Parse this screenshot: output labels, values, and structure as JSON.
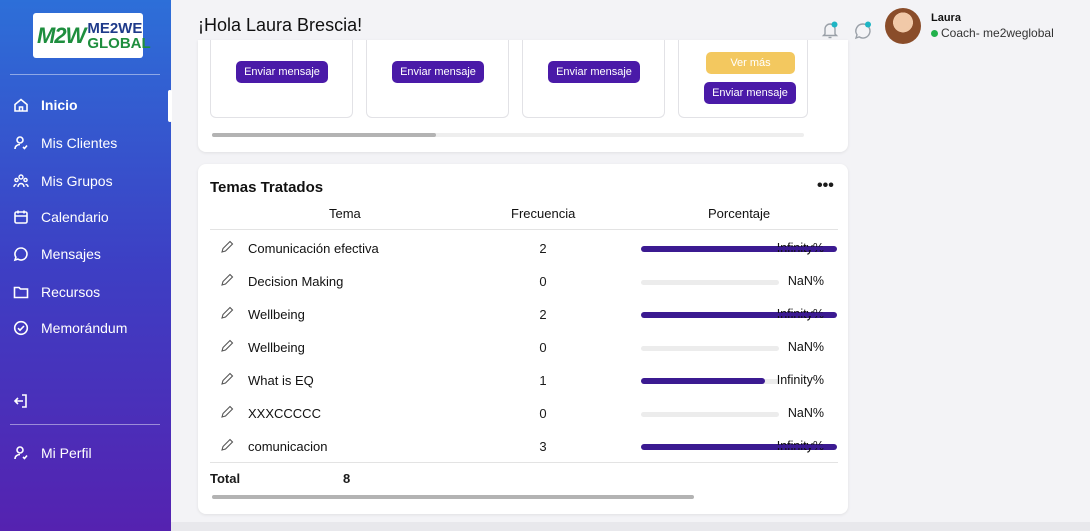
{
  "sidebar": {
    "logo": {
      "mark": "M2W",
      "line1": "ME2WE",
      "line2": "GLOBAL"
    },
    "items": [
      {
        "label": "Inicio",
        "icon": "home-icon",
        "active": true
      },
      {
        "label": "Mis Clientes",
        "icon": "user-icon"
      },
      {
        "label": "Mis Grupos",
        "icon": "group-icon"
      },
      {
        "label": "Calendario",
        "icon": "calendar-icon"
      },
      {
        "label": "Mensajes",
        "icon": "chat-icon"
      },
      {
        "label": "Recursos",
        "icon": "folder-icon"
      },
      {
        "label": "Memorándum",
        "icon": "check-circle-icon"
      }
    ],
    "logout_icon": "logout-icon",
    "profile": {
      "label": "Mi Perfil",
      "icon": "user-icon"
    }
  },
  "header": {
    "greeting": "¡Hola Laura Brescia!",
    "user": {
      "name": "Laura",
      "role": "Coach- me2weglobal",
      "status_color": "#22b14c"
    }
  },
  "clients_card": {
    "send_label": "Enviar mensaje",
    "more_label": "Ver más"
  },
  "topics": {
    "title": "Temas Tratados",
    "more": "•••",
    "columns": {
      "topic": "Tema",
      "frequency": "Frecuencia",
      "percentage": "Porcentaje"
    },
    "rows": [
      {
        "topic": "Comunicación efectiva",
        "frequency": "2",
        "percentage": "Infinity%",
        "fill": 1.0
      },
      {
        "topic": "Decision Making",
        "frequency": "0",
        "percentage": "NaN%",
        "fill": 0
      },
      {
        "topic": "Wellbeing",
        "frequency": "2",
        "percentage": "Infinity%",
        "fill": 1.0
      },
      {
        "topic": "Wellbeing",
        "frequency": "0",
        "percentage": "NaN%",
        "fill": 0
      },
      {
        "topic": "What is EQ",
        "frequency": "1",
        "percentage": "Infinity%",
        "fill": 0.9
      },
      {
        "topic": "XXXCCCCC",
        "frequency": "0",
        "percentage": "NaN%",
        "fill": 0
      },
      {
        "topic": "comunicacion",
        "frequency": "3",
        "percentage": "Infinity%",
        "fill": 1.0
      }
    ],
    "total_label": "Total",
    "total_value": "8"
  },
  "colors": {
    "accent": "#4a1aa8",
    "bar": "#3b1a91",
    "yellow": "#f3c85f"
  }
}
